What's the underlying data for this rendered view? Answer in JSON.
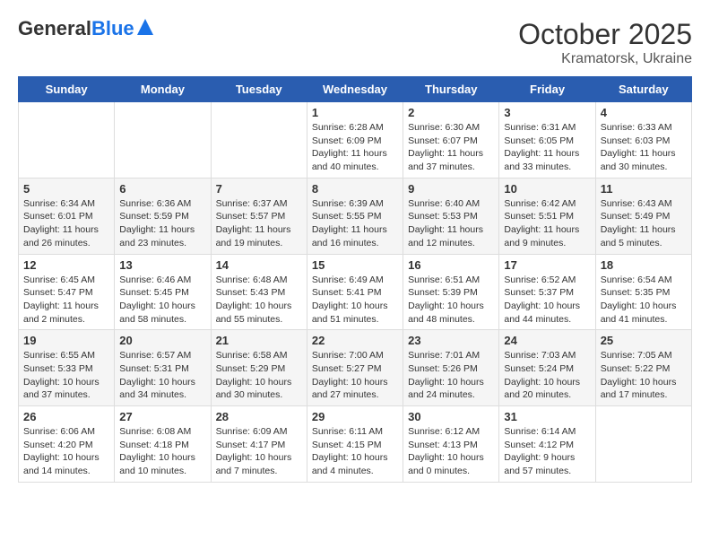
{
  "header": {
    "logo_general": "General",
    "logo_blue": "Blue",
    "month": "October 2025",
    "location": "Kramatorsk, Ukraine"
  },
  "weekdays": [
    "Sunday",
    "Monday",
    "Tuesday",
    "Wednesday",
    "Thursday",
    "Friday",
    "Saturday"
  ],
  "weeks": [
    [
      {
        "day": "",
        "info": ""
      },
      {
        "day": "",
        "info": ""
      },
      {
        "day": "",
        "info": ""
      },
      {
        "day": "1",
        "info": "Sunrise: 6:28 AM\nSunset: 6:09 PM\nDaylight: 11 hours\nand 40 minutes."
      },
      {
        "day": "2",
        "info": "Sunrise: 6:30 AM\nSunset: 6:07 PM\nDaylight: 11 hours\nand 37 minutes."
      },
      {
        "day": "3",
        "info": "Sunrise: 6:31 AM\nSunset: 6:05 PM\nDaylight: 11 hours\nand 33 minutes."
      },
      {
        "day": "4",
        "info": "Sunrise: 6:33 AM\nSunset: 6:03 PM\nDaylight: 11 hours\nand 30 minutes."
      }
    ],
    [
      {
        "day": "5",
        "info": "Sunrise: 6:34 AM\nSunset: 6:01 PM\nDaylight: 11 hours\nand 26 minutes."
      },
      {
        "day": "6",
        "info": "Sunrise: 6:36 AM\nSunset: 5:59 PM\nDaylight: 11 hours\nand 23 minutes."
      },
      {
        "day": "7",
        "info": "Sunrise: 6:37 AM\nSunset: 5:57 PM\nDaylight: 11 hours\nand 19 minutes."
      },
      {
        "day": "8",
        "info": "Sunrise: 6:39 AM\nSunset: 5:55 PM\nDaylight: 11 hours\nand 16 minutes."
      },
      {
        "day": "9",
        "info": "Sunrise: 6:40 AM\nSunset: 5:53 PM\nDaylight: 11 hours\nand 12 minutes."
      },
      {
        "day": "10",
        "info": "Sunrise: 6:42 AM\nSunset: 5:51 PM\nDaylight: 11 hours\nand 9 minutes."
      },
      {
        "day": "11",
        "info": "Sunrise: 6:43 AM\nSunset: 5:49 PM\nDaylight: 11 hours\nand 5 minutes."
      }
    ],
    [
      {
        "day": "12",
        "info": "Sunrise: 6:45 AM\nSunset: 5:47 PM\nDaylight: 11 hours\nand 2 minutes."
      },
      {
        "day": "13",
        "info": "Sunrise: 6:46 AM\nSunset: 5:45 PM\nDaylight: 10 hours\nand 58 minutes."
      },
      {
        "day": "14",
        "info": "Sunrise: 6:48 AM\nSunset: 5:43 PM\nDaylight: 10 hours\nand 55 minutes."
      },
      {
        "day": "15",
        "info": "Sunrise: 6:49 AM\nSunset: 5:41 PM\nDaylight: 10 hours\nand 51 minutes."
      },
      {
        "day": "16",
        "info": "Sunrise: 6:51 AM\nSunset: 5:39 PM\nDaylight: 10 hours\nand 48 minutes."
      },
      {
        "day": "17",
        "info": "Sunrise: 6:52 AM\nSunset: 5:37 PM\nDaylight: 10 hours\nand 44 minutes."
      },
      {
        "day": "18",
        "info": "Sunrise: 6:54 AM\nSunset: 5:35 PM\nDaylight: 10 hours\nand 41 minutes."
      }
    ],
    [
      {
        "day": "19",
        "info": "Sunrise: 6:55 AM\nSunset: 5:33 PM\nDaylight: 10 hours\nand 37 minutes."
      },
      {
        "day": "20",
        "info": "Sunrise: 6:57 AM\nSunset: 5:31 PM\nDaylight: 10 hours\nand 34 minutes."
      },
      {
        "day": "21",
        "info": "Sunrise: 6:58 AM\nSunset: 5:29 PM\nDaylight: 10 hours\nand 30 minutes."
      },
      {
        "day": "22",
        "info": "Sunrise: 7:00 AM\nSunset: 5:27 PM\nDaylight: 10 hours\nand 27 minutes."
      },
      {
        "day": "23",
        "info": "Sunrise: 7:01 AM\nSunset: 5:26 PM\nDaylight: 10 hours\nand 24 minutes."
      },
      {
        "day": "24",
        "info": "Sunrise: 7:03 AM\nSunset: 5:24 PM\nDaylight: 10 hours\nand 20 minutes."
      },
      {
        "day": "25",
        "info": "Sunrise: 7:05 AM\nSunset: 5:22 PM\nDaylight: 10 hours\nand 17 minutes."
      }
    ],
    [
      {
        "day": "26",
        "info": "Sunrise: 6:06 AM\nSunset: 4:20 PM\nDaylight: 10 hours\nand 14 minutes."
      },
      {
        "day": "27",
        "info": "Sunrise: 6:08 AM\nSunset: 4:18 PM\nDaylight: 10 hours\nand 10 minutes."
      },
      {
        "day": "28",
        "info": "Sunrise: 6:09 AM\nSunset: 4:17 PM\nDaylight: 10 hours\nand 7 minutes."
      },
      {
        "day": "29",
        "info": "Sunrise: 6:11 AM\nSunset: 4:15 PM\nDaylight: 10 hours\nand 4 minutes."
      },
      {
        "day": "30",
        "info": "Sunrise: 6:12 AM\nSunset: 4:13 PM\nDaylight: 10 hours\nand 0 minutes."
      },
      {
        "day": "31",
        "info": "Sunrise: 6:14 AM\nSunset: 4:12 PM\nDaylight: 9 hours\nand 57 minutes."
      },
      {
        "day": "",
        "info": ""
      }
    ]
  ]
}
